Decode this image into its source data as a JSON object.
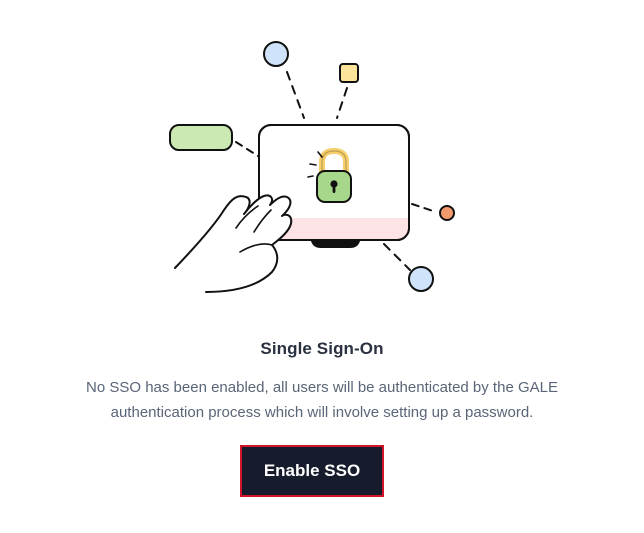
{
  "illustration": {
    "icon": "monitor-with-lock",
    "lock_body_color": "#a6d78a",
    "lock_shackle_color": "#f6cf6a",
    "screen_bottom_color": "#fde3e6",
    "node_blue_color": "#cfe4fb",
    "node_yellow_color": "#fde49b",
    "node_orange_color": "#f39a6e",
    "pill_green_color": "#cbeab3"
  },
  "empty_state": {
    "title": "Single Sign-On",
    "description": "No SSO has been enabled, all users will be authenticated by the GALE authentication process which will involve setting up a password.",
    "button_label": "Enable SSO"
  },
  "colors": {
    "button_bg": "#161c2b",
    "button_border_highlight": "#d0142a",
    "title_text": "#2a3140",
    "body_text": "#5a6577"
  }
}
